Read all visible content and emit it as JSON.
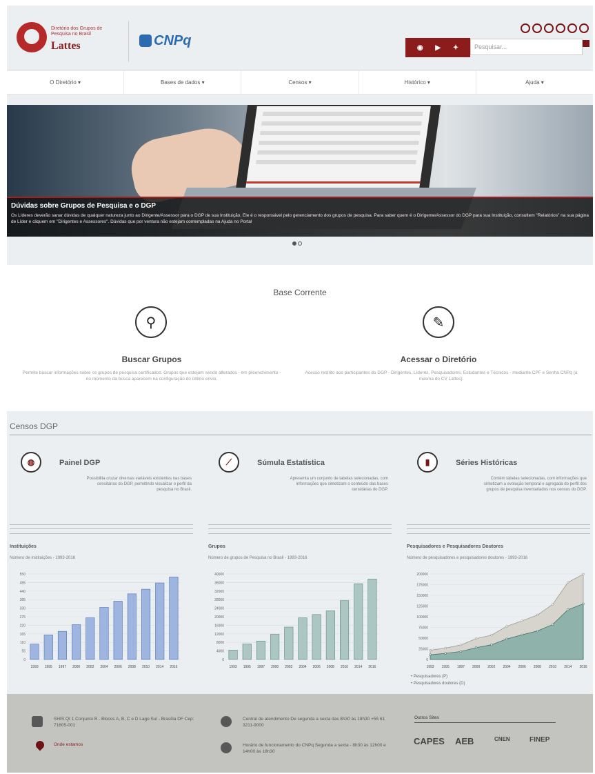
{
  "header": {
    "logo_text": "Diretório dos Grupos de Pesquisa no Brasil",
    "logo_word": "Lattes",
    "cnpq": "CNPq",
    "search_placeholder": "Pesquisar...",
    "social": [
      "rss-icon",
      "youtube-icon",
      "twitter-icon"
    ]
  },
  "nav": {
    "items": [
      "O Diretório ▾",
      "Bases de dados ▾",
      "Censos ▾",
      "Histórico ▾",
      "Ajuda ▾"
    ]
  },
  "hero": {
    "title": "Dúvidas sobre Grupos de Pesquisa e o DGP",
    "text": "Os Líderes deverão sanar dúvidas de qualquer natureza junto ao Dirigente/Assessor para o DGP de sua Instituição. Ele é o responsável pelo gerenciamento dos grupos de pesquisa. Para saber quem é o Dirigente/Assessor do DGP para sua Instituição, consultem \"Relatórios\" na sua página de Líder e cliquem em \"Dirigentes e Assessores\". Dúvidas que por ventura não estejam contempladas na Ajuda no Portal"
  },
  "base": {
    "title": "Base Corrente",
    "cards": [
      {
        "title": "Buscar Grupos",
        "desc": "Permite buscar informações sobre os grupos de pesquisa certificados. Grupos que estejam sendo alterados - em preenchimento - no momento da busca aparecem na configuração do último envio."
      },
      {
        "title": "Acessar o Diretório",
        "desc": "Acesso restrito aos participantes do DGP - Dirigentes, Líderes, Pesquisadores, Estudantes e Técnicos - mediante CPF e Senha CNPq (a mesma do CV Lattes)."
      }
    ]
  },
  "censos": {
    "title": "Censos DGP",
    "cards": [
      {
        "title": "Painel DGP",
        "desc": "Possibilita cruzar diversas variáveis existentes nas bases censitárias do DGP, permitindo visualizar o perfil da pesquisa no Brasil."
      },
      {
        "title": "Súmula Estatística",
        "desc": "Apresenta um conjunto de tabelas selecionadas, com informações que sintetizam o conteúdo das bases censitárias do DGP."
      },
      {
        "title": "Séries Históricas",
        "desc": "Contém tabelas selecionadas, com informações que sintetizam a evolução temporal e agregada do perfil dos grupos de pesquisa inventariados nos censos do DGP."
      }
    ]
  },
  "chart_data": [
    {
      "type": "bar",
      "title": "Instituições",
      "subtitle": "Número de instituições - 1993-2016",
      "categories": [
        "1993",
        "1995",
        "1997",
        "2000",
        "2002",
        "2004",
        "2006",
        "2008",
        "2010",
        "2014",
        "2016"
      ],
      "values": [
        99,
        158,
        181,
        224,
        268,
        335,
        375,
        422,
        452,
        492,
        531
      ],
      "ylim": [
        0,
        550
      ]
    },
    {
      "type": "bar",
      "title": "Grupos",
      "subtitle": "Número de grupos de Pesquisa no Brasil - 1993-2016",
      "categories": [
        "1993",
        "1995",
        "1997",
        "2000",
        "2002",
        "2004",
        "2006",
        "2008",
        "2010",
        "2014",
        "2016"
      ],
      "values": [
        4402,
        7271,
        8632,
        11760,
        15158,
        19470,
        21024,
        22797,
        27523,
        35424,
        37640
      ],
      "ylim": [
        0,
        40000
      ]
    },
    {
      "type": "area",
      "title": "Pesquisadores e Pesquisadores Doutores",
      "subtitle": "Número de pesquisadores e pesquisadores doutores - 1993-2016",
      "x": [
        "1993",
        "1995",
        "1997",
        "2000",
        "2002",
        "2004",
        "2006",
        "2008",
        "2010",
        "2014",
        "2016"
      ],
      "series": [
        {
          "name": "Pesquisadores (P)",
          "values": [
            21541,
            26779,
            33980,
            48781,
            56891,
            77649,
            90320,
            104018,
            128892,
            180262,
            199566
          ]
        },
        {
          "name": "Pesquisadores doutores (D)",
          "values": [
            10994,
            14308,
            18724,
            27662,
            34349,
            47973,
            57586,
            66785,
            81726,
            116427,
            130140
          ]
        }
      ],
      "ylim": [
        0,
        200000
      ]
    }
  ],
  "footer": {
    "address": "SHIS QI 1 Conjunto B - Blocos A, B, C e D Lago Sul - Brasília DF Cep: 71605-001",
    "map_link": "Onde estamos",
    "central": "Central de atendimento De segunda a sexta das 8h30 às 18h30 +55 61 3211-9000",
    "hours": "Horário de funcionamento do CNPq Segunda a sexta - 8h30 às 12h00 e 14h00 às 18h30",
    "others": "Outros Sites",
    "partners": [
      "CAPES",
      "AEB",
      "CNEN",
      "FINEP"
    ]
  }
}
